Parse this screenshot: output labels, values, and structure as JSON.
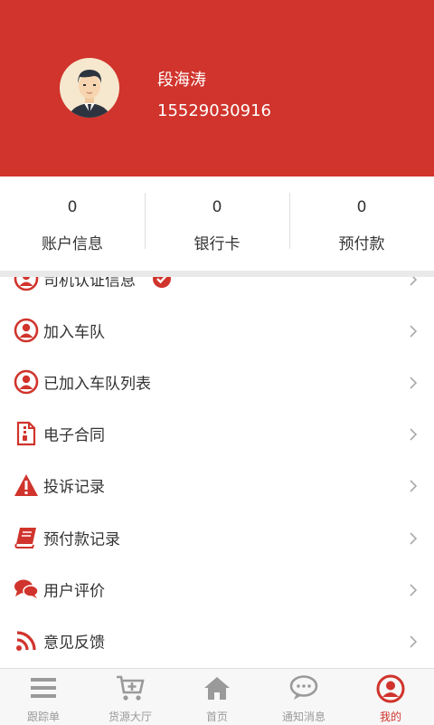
{
  "profile": {
    "name": "段海涛",
    "phone": "15529030916"
  },
  "stats": [
    {
      "value": "0",
      "label": "账户信息"
    },
    {
      "value": "0",
      "label": "银行卡"
    },
    {
      "value": "0",
      "label": "预付款"
    }
  ],
  "menu": {
    "items": [
      {
        "label": "司机认证信息",
        "icon": "person-circle-icon"
      },
      {
        "label": "加入车队",
        "icon": "person-circle-icon"
      },
      {
        "label": "已加入车队列表",
        "icon": "person-circle-icon"
      },
      {
        "label": "电子合同",
        "icon": "document-zip-icon"
      },
      {
        "label": "投诉记录",
        "icon": "warning-icon"
      },
      {
        "label": "预付款记录",
        "icon": "book-icon"
      },
      {
        "label": "用户评价",
        "icon": "chat-bubbles-icon"
      },
      {
        "label": "意见反馈",
        "icon": "rss-icon"
      }
    ]
  },
  "nav": {
    "items": [
      {
        "label": "跟踪单",
        "icon": "menu-lines-icon"
      },
      {
        "label": "货源大厅",
        "icon": "cart-plus-icon"
      },
      {
        "label": "首页",
        "icon": "home-icon"
      },
      {
        "label": "通知消息",
        "icon": "speech-bubble-icon"
      },
      {
        "label": "我的",
        "icon": "user-circle-icon",
        "active": true
      }
    ]
  },
  "colors": {
    "accent": "#d0342c",
    "inactive": "#9a9a9a"
  }
}
